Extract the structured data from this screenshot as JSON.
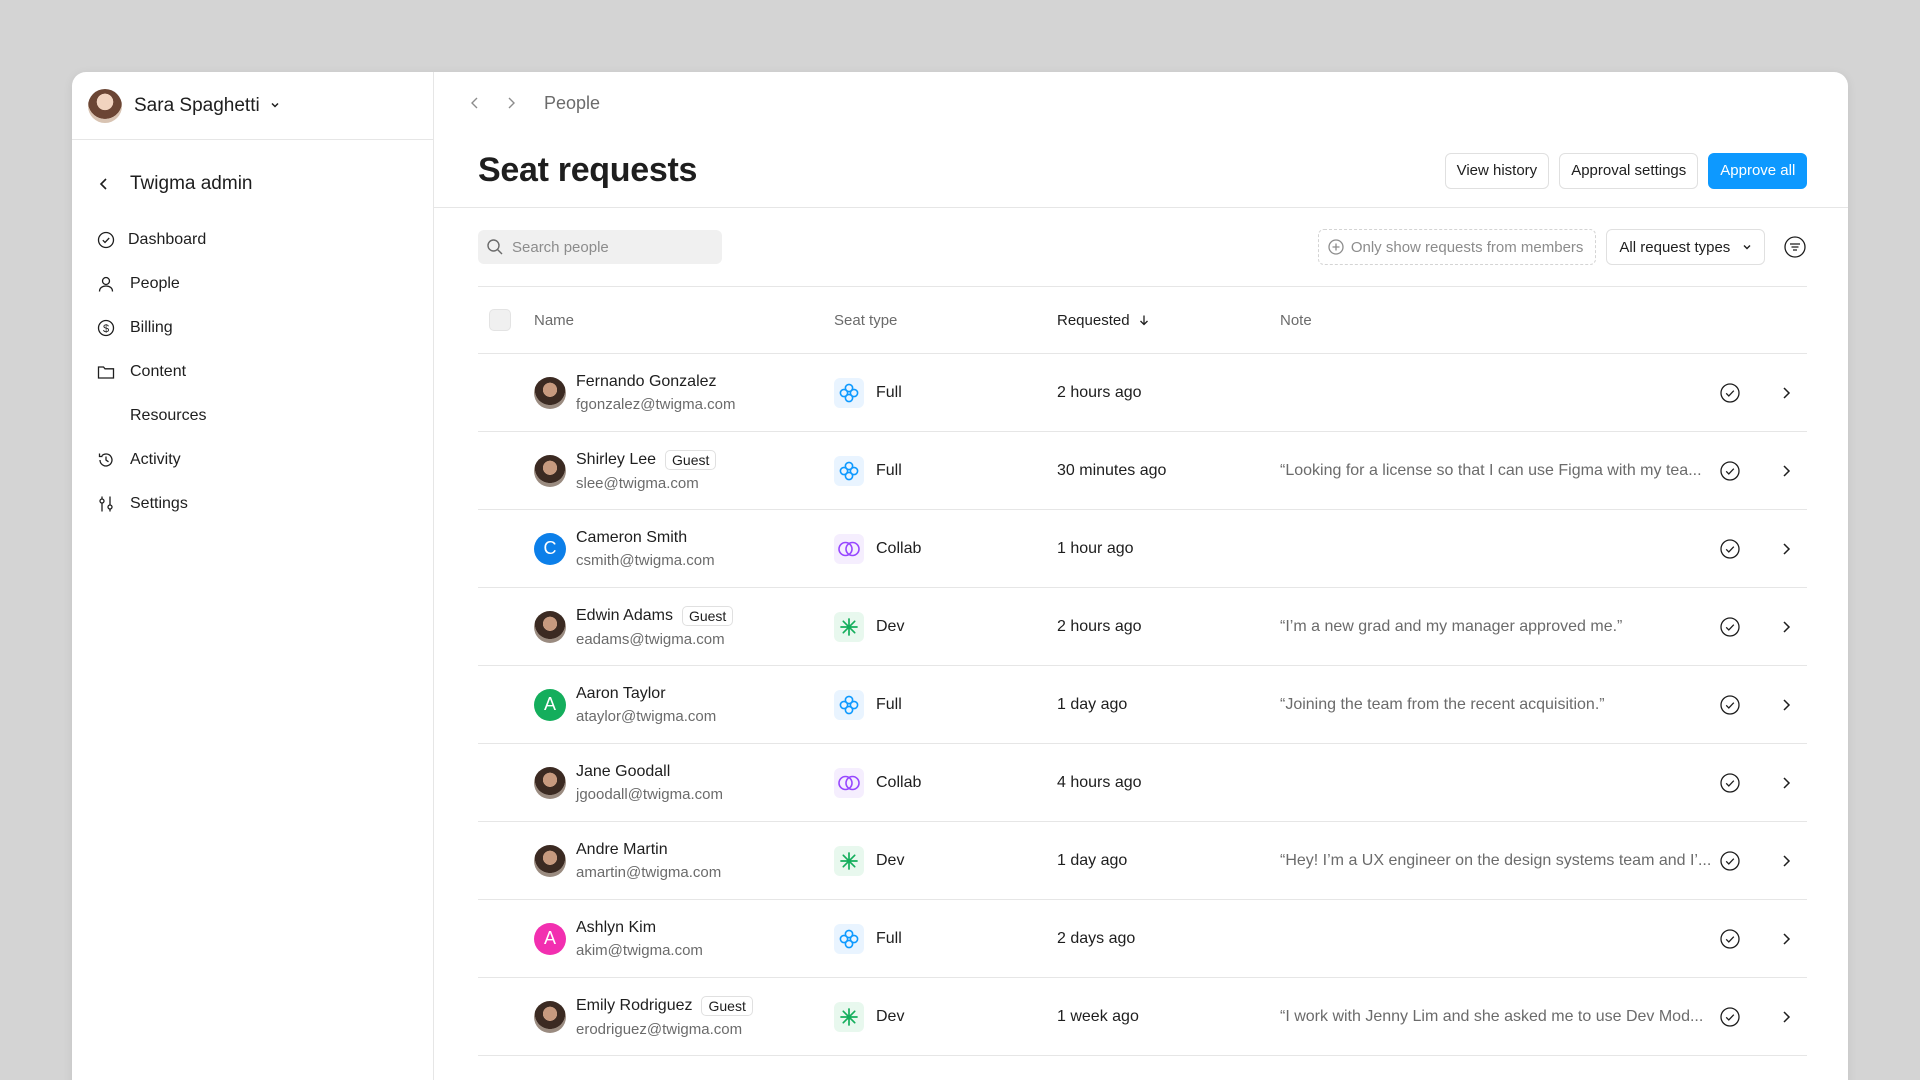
{
  "user": {
    "name": "Sara Spaghetti"
  },
  "admin": {
    "title": "Twigma admin"
  },
  "nav": [
    {
      "label": "Dashboard",
      "icon": "dashboard-check-icon"
    },
    {
      "label": "People",
      "icon": "person-icon"
    },
    {
      "label": "Billing",
      "icon": "dollar-icon"
    },
    {
      "label": "Content",
      "icon": "folder-icon"
    },
    {
      "label": "Resources",
      "icon": ""
    },
    {
      "label": "Activity",
      "icon": "history-icon"
    },
    {
      "label": "Settings",
      "icon": "sliders-icon"
    }
  ],
  "breadcrumb": "People",
  "page": {
    "title": "Seat requests",
    "view_history": "View history",
    "approval_settings": "Approval settings",
    "approve_all": "Approve all"
  },
  "toolbar": {
    "search_placeholder": "Search people",
    "members_filter": "Only show requests from members",
    "request_types": "All request types"
  },
  "table": {
    "headers": {
      "name": "Name",
      "seat": "Seat type",
      "requested": "Requested",
      "note": "Note"
    },
    "rows": [
      {
        "name": "Fernando Gonzalez",
        "email": "fgonzalez@twigma.com",
        "guest": "",
        "seat": "Full",
        "requested": "2 hours ago",
        "note": "",
        "avatar": "photo"
      },
      {
        "name": "Shirley Lee",
        "email": "slee@twigma.com",
        "guest": "Guest",
        "seat": "Full",
        "requested": "30 minutes ago",
        "note": "“Looking for a license so that I can use Figma with my tea...",
        "avatar": "photo"
      },
      {
        "name": "Cameron Smith",
        "email": "csmith@twigma.com",
        "guest": "",
        "seat": "Collab",
        "requested": "1 hour ago",
        "note": "",
        "avatar": "C",
        "color": "#0c7fe9"
      },
      {
        "name": "Edwin Adams",
        "email": "eadams@twigma.com",
        "guest": "Guest",
        "seat": "Dev",
        "requested": "2 hours ago",
        "note": "“I’m a new grad and my manager approved me.”",
        "avatar": "photo"
      },
      {
        "name": "Aaron Taylor",
        "email": "ataylor@twigma.com",
        "guest": "",
        "seat": "Full",
        "requested": "1 day ago",
        "note": "“Joining the team from the recent acquisition.”",
        "avatar": "A",
        "color": "#14ae5c"
      },
      {
        "name": "Jane Goodall",
        "email": "jgoodall@twigma.com",
        "guest": "",
        "seat": "Collab",
        "requested": "4 hours ago",
        "note": "",
        "avatar": "photo"
      },
      {
        "name": "Andre Martin",
        "email": "amartin@twigma.com",
        "guest": "",
        "seat": "Dev",
        "requested": "1 day ago",
        "note": "“Hey! I’m a UX engineer on the design systems team and I’...",
        "avatar": "photo"
      },
      {
        "name": "Ashlyn Kim",
        "email": "akim@twigma.com",
        "guest": "",
        "seat": "Full",
        "requested": "2 days ago",
        "note": "",
        "avatar": "A",
        "color": "#f22fb0"
      },
      {
        "name": "Emily Rodriguez",
        "email": "erodriguez@twigma.com",
        "guest": "Guest",
        "seat": "Dev",
        "requested": "1 week ago",
        "note": "“I work with Jenny Lim and she asked me to use Dev Mod...",
        "avatar": "photo"
      }
    ]
  },
  "colors": {
    "accent": "#0d99ff",
    "full": "#0d99ff",
    "collab": "#9747ff",
    "dev": "#14ae5c"
  }
}
